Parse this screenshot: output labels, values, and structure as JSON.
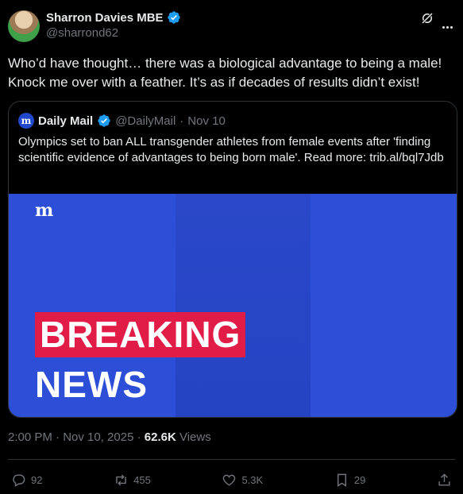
{
  "author": {
    "name": "Sharron Davies MBE",
    "handle": "@sharrond62"
  },
  "tweet": {
    "text": "Who’d have thought… there was a biological advantage to being a male! Knock me over with a feather. It’s as if decades of results didn’t exist!"
  },
  "quote": {
    "logo_text": "m",
    "name": "Daily Mail",
    "handle": "@DailyMail",
    "separator": "·",
    "date": "Nov 10",
    "text": "Olympics set to ban ALL transgender athletes from female events after 'finding scientific evidence of advantages to being born male'. Read more: trib.al/bql7Jdb",
    "image": {
      "logo": "m",
      "banner_top": "BREAKING",
      "banner_bottom": "NEWS"
    }
  },
  "meta": {
    "timestamp": "2:00 PM · Nov 10, 2025",
    "separator": "·",
    "views_count": "62.6K",
    "views_label": "Views"
  },
  "actions": {
    "replies": "92",
    "reposts": "455",
    "likes": "5.3K",
    "bookmarks": "29"
  },
  "colors": {
    "verified": "#1d9bf0",
    "daily_mail_blue": "#2148cc",
    "breaking_red": "#e01c47",
    "image_blue": "#2d4fd8"
  },
  "icons": [
    "verified-badge-icon",
    "grok-icon",
    "more-icon",
    "reply-icon",
    "repost-icon",
    "like-icon",
    "bookmark-icon",
    "share-icon"
  ]
}
